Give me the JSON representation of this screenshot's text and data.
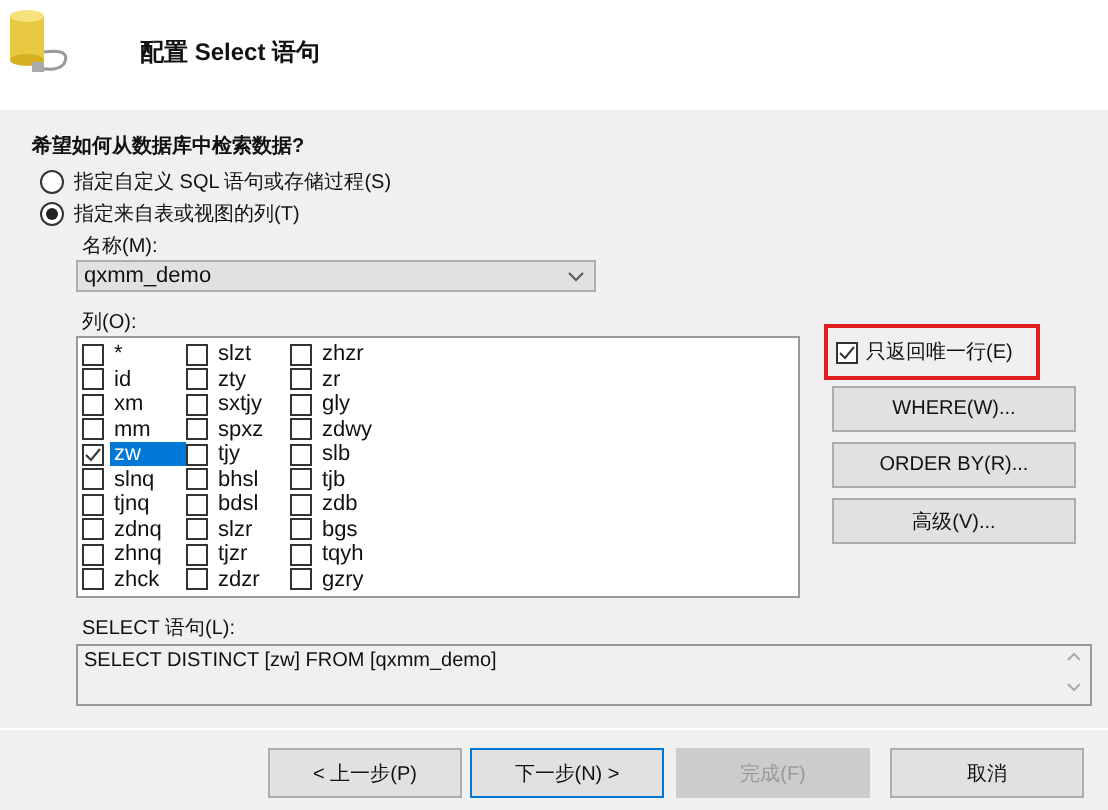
{
  "header": {
    "title": "配置 Select 语句"
  },
  "question": "希望如何从数据库中检索数据?",
  "options": [
    {
      "label": "指定自定义 SQL 语句或存储过程(S)",
      "selected": false
    },
    {
      "label": "指定来自表或视图的列(T)",
      "selected": true
    }
  ],
  "name_label": "名称(M):",
  "name_value": "qxmm_demo",
  "columns_label": "列(O):",
  "columns": [
    {
      "name": "*",
      "checked": false,
      "selected": false
    },
    {
      "name": "id",
      "checked": false,
      "selected": false
    },
    {
      "name": "xm",
      "checked": false,
      "selected": false
    },
    {
      "name": "mm",
      "checked": false,
      "selected": false
    },
    {
      "name": "zw",
      "checked": true,
      "selected": true
    },
    {
      "name": "slnq",
      "checked": false,
      "selected": false
    },
    {
      "name": "tjnq",
      "checked": false,
      "selected": false
    },
    {
      "name": "zdnq",
      "checked": false,
      "selected": false
    },
    {
      "name": "zhnq",
      "checked": false,
      "selected": false
    },
    {
      "name": "zhck",
      "checked": false,
      "selected": false
    },
    {
      "name": "slzt",
      "checked": false,
      "selected": false
    },
    {
      "name": "zty",
      "checked": false,
      "selected": false
    },
    {
      "name": "sxtjy",
      "checked": false,
      "selected": false
    },
    {
      "name": "spxz",
      "checked": false,
      "selected": false
    },
    {
      "name": "tjy",
      "checked": false,
      "selected": false
    },
    {
      "name": "bhsl",
      "checked": false,
      "selected": false
    },
    {
      "name": "bdsl",
      "checked": false,
      "selected": false
    },
    {
      "name": "slzr",
      "checked": false,
      "selected": false
    },
    {
      "name": "tjzr",
      "checked": false,
      "selected": false
    },
    {
      "name": "zdzr",
      "checked": false,
      "selected": false
    },
    {
      "name": "zhzr",
      "checked": false,
      "selected": false
    },
    {
      "name": "zr",
      "checked": false,
      "selected": false
    },
    {
      "name": "gly",
      "checked": false,
      "selected": false
    },
    {
      "name": "zdwy",
      "checked": false,
      "selected": false
    },
    {
      "name": "slb",
      "checked": false,
      "selected": false
    },
    {
      "name": "tjb",
      "checked": false,
      "selected": false
    },
    {
      "name": "zdb",
      "checked": false,
      "selected": false
    },
    {
      "name": "bgs",
      "checked": false,
      "selected": false
    },
    {
      "name": "tqyh",
      "checked": false,
      "selected": false
    },
    {
      "name": "gzry",
      "checked": false,
      "selected": false
    }
  ],
  "unique_row": {
    "label": "只返回唯一行(E)",
    "checked": true,
    "highlighted": true
  },
  "side_buttons": [
    "WHERE(W)...",
    "ORDER BY(R)...",
    "高级(V)..."
  ],
  "sql_label": "SELECT 语句(L):",
  "sql_text": "SELECT DISTINCT [zw] FROM [qxmm_demo]",
  "footer_buttons": [
    {
      "label": "< 上一步(P)",
      "disabled": false,
      "focused": false
    },
    {
      "label": "下一步(N) >",
      "disabled": false,
      "focused": true
    },
    {
      "label": "完成(F)",
      "disabled": true,
      "focused": false
    },
    {
      "label": "取消",
      "disabled": false,
      "focused": false
    }
  ]
}
